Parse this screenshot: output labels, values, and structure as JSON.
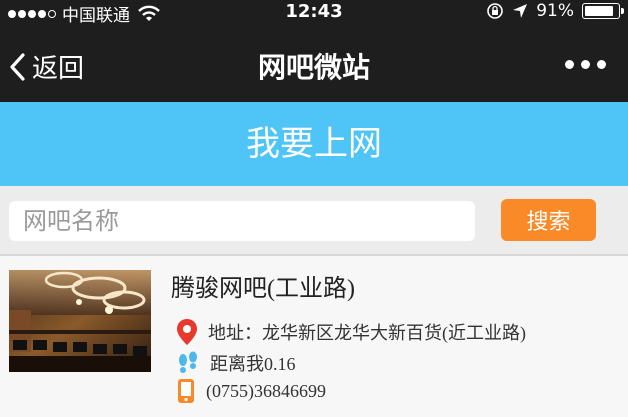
{
  "statusbar": {
    "carrier": "中国联通",
    "time": "12:43",
    "battery": "91%",
    "battery_level": 0.91,
    "signal_bars": 4
  },
  "navbar": {
    "back_label": "返回",
    "title": "网吧微站"
  },
  "banner": {
    "text": "我要上网"
  },
  "search": {
    "placeholder": "网吧名称",
    "button_label": "搜索"
  },
  "listing": {
    "name": "腾骏网吧(工业路)",
    "address": "地址：龙华新区龙华大新百货(近工业路)",
    "distance": "距离我0.16",
    "phone": "(0755)36846699"
  },
  "colors": {
    "bar_bg": "#1e1e1e",
    "banner_bg": "#4fc4f7",
    "button_bg": "#f98a27",
    "pin_red": "#e8392d",
    "foot_blue": "#4fb8ea",
    "phone_orange": "#f98a27"
  },
  "icons": [
    "wifi-icon",
    "lock-rotation-icon",
    "location-arrow-icon",
    "battery-icon",
    "back-chevron-icon",
    "more-icon",
    "map-pin-icon",
    "footprints-icon",
    "phone-icon"
  ]
}
